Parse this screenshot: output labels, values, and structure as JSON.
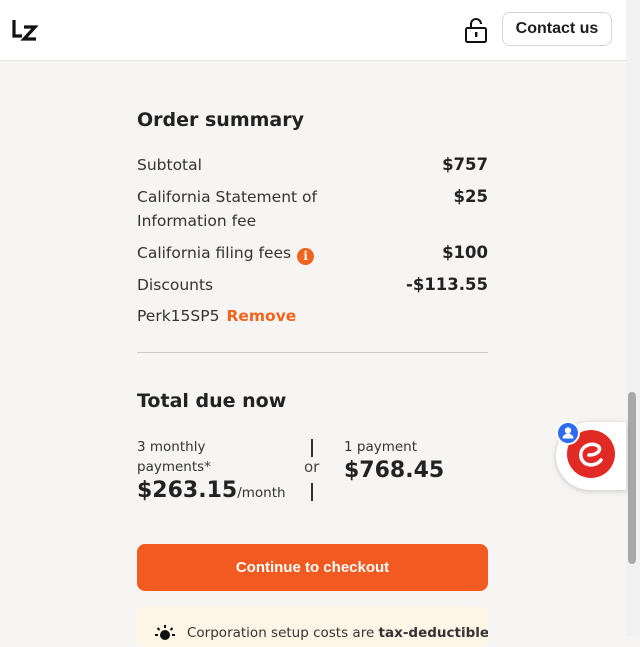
{
  "header": {
    "logo_icon": "legalzoom-lz-logo",
    "lock_icon": "lock-icon",
    "contact_label": "Contact us"
  },
  "order_summary": {
    "title": "Order summary",
    "rows": [
      {
        "label": "Subtotal",
        "value": "$757"
      },
      {
        "label_line1": "California Statement of",
        "label_line2": "Information fee",
        "value": "$25"
      },
      {
        "label": "California filing fees",
        "value": "$100",
        "info_icon": "info-icon"
      },
      {
        "label": "Discounts",
        "value": "-$113.55"
      }
    ],
    "promo": {
      "code": "Perk15SP5",
      "remove_label": "Remove"
    }
  },
  "total": {
    "title": "Total due now",
    "monthly": {
      "line1": "3 monthly",
      "line2": "payments*",
      "amount": "$263.15",
      "unit": "/month"
    },
    "or_label": "or",
    "single": {
      "label": "1 payment",
      "amount": "$768.45"
    }
  },
  "checkout_label": "Continue to checkout",
  "note": {
    "icon": "sun-icon",
    "text_start": "Corporation setup costs are ",
    "text_bold": "tax-deductible"
  },
  "chat": {
    "avatar_icon": "chat-e-icon",
    "badge_icon": "user-badge-icon"
  },
  "colors": {
    "accent": "#f25a22",
    "info": "#f0641e",
    "note_bg": "#fdf6e6",
    "chat_red": "#e22a25",
    "badge_blue": "#2f6cf3"
  }
}
